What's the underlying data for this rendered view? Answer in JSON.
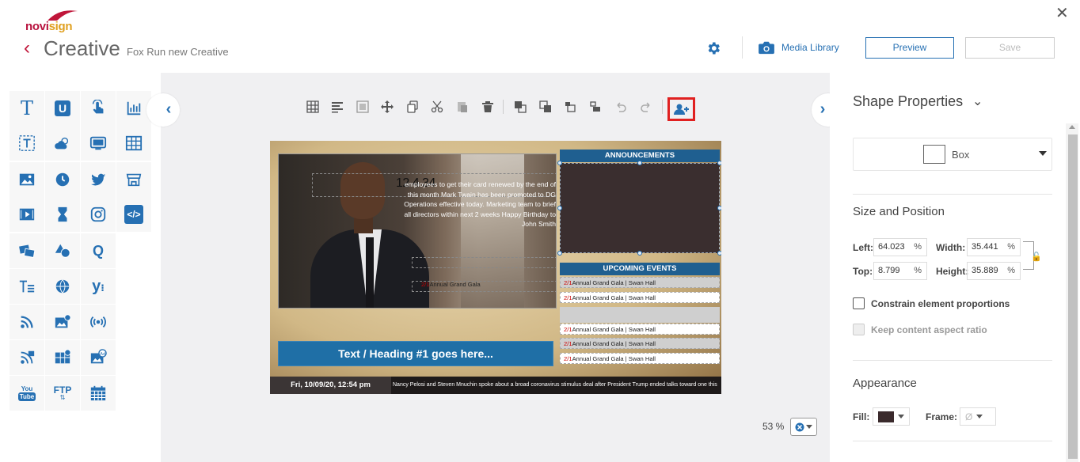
{
  "header": {
    "logo_text_a": "novi",
    "logo_text_b": "sign",
    "app_title": "Creative",
    "creative_name": "Fox Run new Creative",
    "media_library": "Media Library",
    "preview": "Preview",
    "save": "Save"
  },
  "left_panel": {
    "tiles": [
      "text-icon",
      "u-icon",
      "touch-icon",
      "bar-chart-icon",
      "text-frame-icon",
      "weather-icon",
      "screen-icon",
      "table-icon",
      "image-icon",
      "clock-icon",
      "twitter-icon",
      "shop-icon",
      "video-icon",
      "hourglass-icon",
      "instagram-icon",
      "code-icon",
      "slideshow-icon",
      "shapes-icon",
      "q-icon",
      "text-list-icon",
      "globe-icon",
      "yammer-icon",
      "rss-icon",
      "web-image-icon",
      "broadcast-icon",
      "data-feed-icon",
      "web-gallery-icon",
      "ad-image-icon",
      "youtube-icon",
      "ftp-icon",
      "calendar-icon"
    ]
  },
  "canvas": {
    "photo_number": "12 4 34",
    "photo_text": "employees to get their card renewed by the end of this month Mark Twain has been promoted to DG Operations effective today. Marketing team to brief all directors within next 2 weeks Happy Birthday to John Smith",
    "gala_date": "2/1",
    "gala_text": "Annual Grand Gala",
    "announcements": "ANNOUNCEMENTS",
    "upcoming_events": "UPCOMING EVENTS",
    "events": [
      {
        "date": "2/1",
        "text": "Annual Grand Gala | Swan Hall"
      },
      {
        "date": "2/1",
        "text": "Annual Grand Gala | Swan Hall"
      },
      {
        "date": "2/1",
        "text": "Annual Grand Gala | Swan Hall"
      },
      {
        "date": "2/1",
        "text": "Annual Grand Gala | Swan Hall"
      },
      {
        "date": "2/1",
        "text": "Annual Grand Gala | Swan Hall"
      }
    ],
    "heading": "Text / Heading #1 goes here...",
    "datetime": "Fri, 10/09/20, 12:54 pm",
    "ticker": "Nancy Pelosi and Steven Mnuchin spoke about a broad coronavirus stimulus deal after President Trump ended talks toward one this"
  },
  "zoom": {
    "label": "53 %"
  },
  "properties": {
    "title": "Shape Properties",
    "shape_type": "Box",
    "size_position_title": "Size and Position",
    "left_label": "Left:",
    "left_value": "64.023",
    "top_label": "Top:",
    "top_value": "8.799",
    "width_label": "Width:",
    "width_value": "35.441",
    "height_label": "Height:",
    "height_value": "35.889",
    "unit": "%",
    "constrain_label": "Constrain element proportions",
    "keep_aspect_label": "Keep content aspect ratio",
    "appearance_title": "Appearance",
    "fill_label": "Fill:",
    "frame_label": "Frame:",
    "frame_value": "Ø",
    "fill_color": "#3a2a2c"
  },
  "colors": {
    "accent": "#2670b3",
    "brand_red": "#b8123e",
    "highlight": "#e02020"
  }
}
